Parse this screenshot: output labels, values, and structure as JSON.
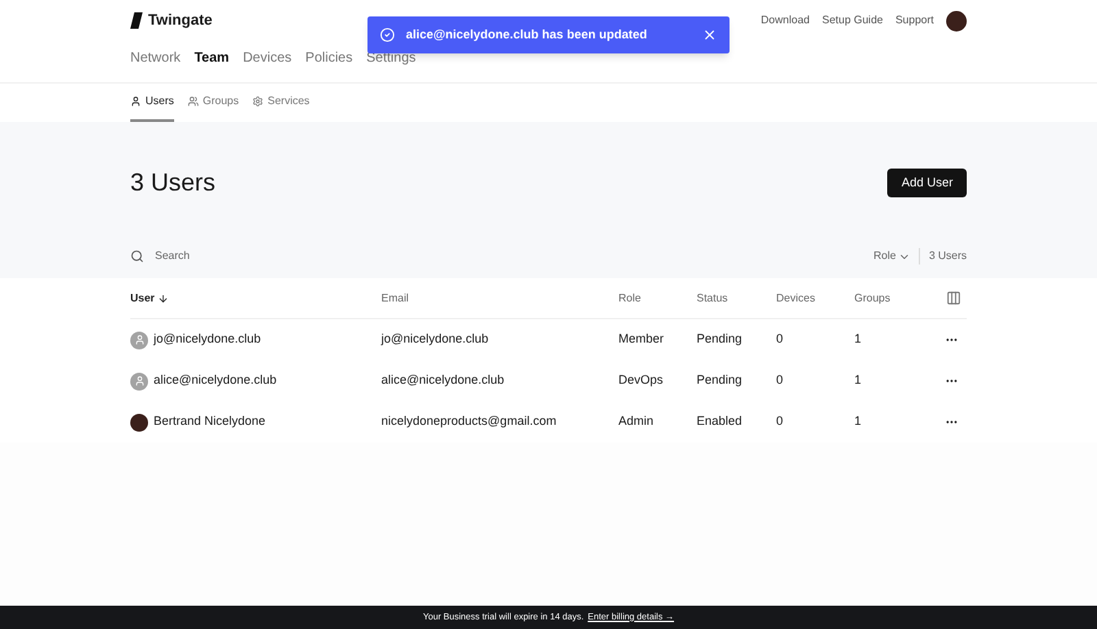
{
  "brand": "Twingate",
  "header_links": [
    "Download",
    "Setup Guide",
    "Support"
  ],
  "nav": [
    {
      "label": "Network",
      "selected": false
    },
    {
      "label": "Team",
      "selected": true
    },
    {
      "label": "Devices",
      "selected": false
    },
    {
      "label": "Policies",
      "selected": false
    },
    {
      "label": "Settings",
      "selected": false
    }
  ],
  "subtabs": [
    {
      "label": "Users",
      "selected": true
    },
    {
      "label": "Groups",
      "selected": false
    },
    {
      "label": "Services",
      "selected": false
    }
  ],
  "toast": {
    "message": "alice@nicelydone.club has been updated"
  },
  "title": "3 Users",
  "add_button": "Add User",
  "search": {
    "placeholder": "Search"
  },
  "role_filter": "Role",
  "count": "3 Users",
  "table": {
    "columns": [
      "User",
      "Email",
      "Role",
      "Status",
      "Devices",
      "Groups"
    ],
    "rows": [
      {
        "kind": "placeholder",
        "user": "jo@nicelydone.club",
        "email": "jo@nicelydone.club",
        "role": "Member",
        "status": "Pending",
        "devices": "0",
        "groups": "1"
      },
      {
        "kind": "placeholder",
        "user": "alice@nicelydone.club",
        "email": "alice@nicelydone.club",
        "role": "DevOps",
        "status": "Pending",
        "devices": "0",
        "groups": "1"
      },
      {
        "kind": "photo",
        "user": "Bertrand Nicelydone",
        "email": "nicelydoneproducts@gmail.com",
        "role": "Admin",
        "status": "Enabled",
        "devices": "0",
        "groups": "1"
      }
    ]
  },
  "banner": {
    "text": "Your Business trial will expire in 14 days.",
    "link": "Enter billing details →"
  }
}
